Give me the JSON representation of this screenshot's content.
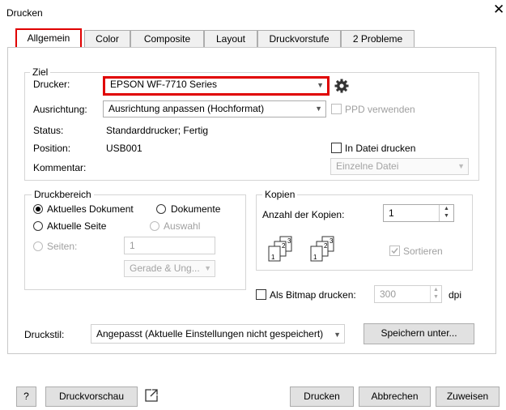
{
  "window": {
    "title": "Drucken",
    "close_glyph": "✕"
  },
  "tabs": [
    {
      "label": "Allgemein",
      "active": true
    },
    {
      "label": "Color"
    },
    {
      "label": "Composite"
    },
    {
      "label": "Layout"
    },
    {
      "label": "Druckvorstufe"
    },
    {
      "label": "2 Probleme"
    }
  ],
  "ziel": {
    "group_label": "Ziel",
    "drucker_label": "Drucker:",
    "drucker_value": "EPSON WF-7710 Series",
    "ausrichtung_label": "Ausrichtung:",
    "ausrichtung_value": "Ausrichtung anpassen (Hochformat)",
    "ppd_label": "PPD verwenden",
    "status_label": "Status:",
    "status_value": "Standarddrucker; Fertig",
    "position_label": "Position:",
    "position_value": "USB001",
    "in_datei_label": "In Datei drucken",
    "kommentar_label": "Kommentar:",
    "einzelne_datei": "Einzelne Datei"
  },
  "druckbereich": {
    "group_label": "Druckbereich",
    "aktuelles_dokument": "Aktuelles Dokument",
    "dokumente": "Dokumente",
    "aktuelle_seite": "Aktuelle Seite",
    "auswahl": "Auswahl",
    "seiten": "Seiten:",
    "seiten_value": "1",
    "gerade_ungerade": "Gerade & Ung..."
  },
  "kopien": {
    "group_label": "Kopien",
    "anzahl_label": "Anzahl der Kopien:",
    "anzahl_value": "1",
    "sortieren": "Sortieren"
  },
  "bitmap": {
    "label": "Als Bitmap drucken:",
    "dpi_value": "300",
    "dpi_unit": "dpi"
  },
  "druckstil": {
    "label": "Druckstil:",
    "value": "Angepasst (Aktuelle Einstellungen nicht gespeichert)",
    "speichern_button": "Speichern unter..."
  },
  "footer": {
    "help": "?",
    "druckvorschau": "Druckvorschau",
    "drucken": "Drucken",
    "abbrechen": "Abbrechen",
    "zuweisen": "Zuweisen"
  },
  "colors": {
    "highlight_red": "#e00000"
  }
}
